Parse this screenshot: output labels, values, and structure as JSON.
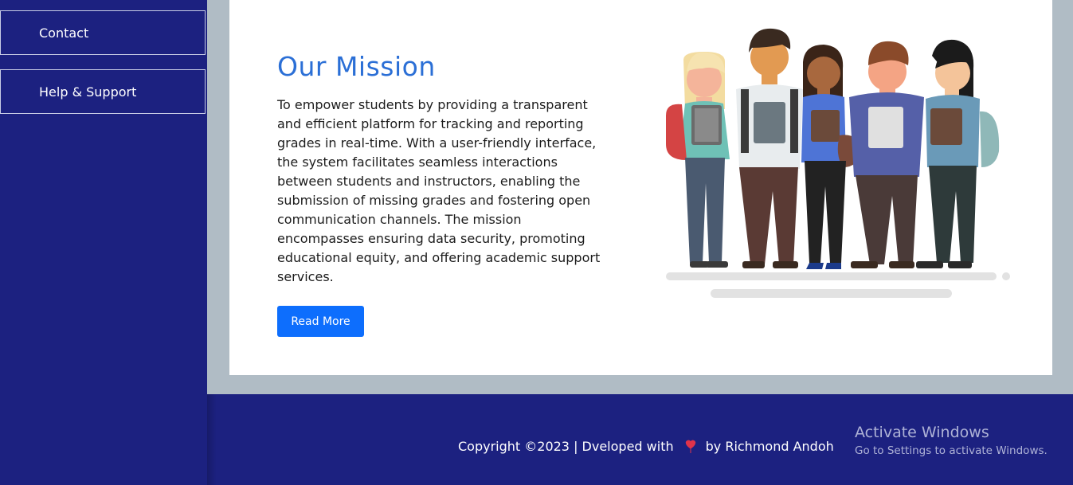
{
  "sidebar": {
    "items": [
      {
        "label": "Contact"
      },
      {
        "label": "Help & Support"
      }
    ]
  },
  "mission": {
    "title": "Our Mission",
    "body": "To empower students by providing a transparent and efficient platform for tracking and reporting grades in real-time. With a user-friendly interface, the system facilitates seamless interactions between students and instructors, enabling the submission of missing grades and fostering open communication channels. The mission encompasses ensuring data security, promoting educational equity, and offering academic support services.",
    "button_label": "Read More"
  },
  "illustration": {
    "icon": "students-illustration"
  },
  "footer": {
    "copyright_prefix": "Copyright ©2023 | Dveloped with",
    "heart_icon": "heart-icon",
    "copyright_suffix": "by Richmond Andoh"
  },
  "watermark": {
    "line1": "Activate Windows",
    "line2": "Go to Settings to activate Windows."
  },
  "colors": {
    "sidebar_bg": "#1c2180",
    "accent_title": "#2b6fd6",
    "button_bg": "#0d6efd",
    "page_bg": "#b0bcc5",
    "heart": "#e0334a"
  }
}
